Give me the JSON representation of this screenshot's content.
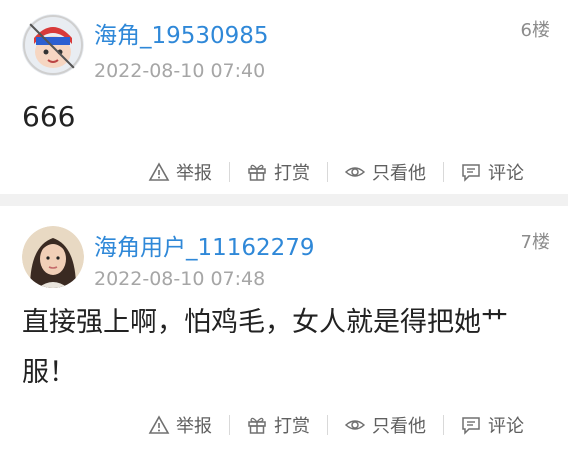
{
  "posts": [
    {
      "username": "海角_19530985",
      "floor": "6楼",
      "time": "2022-08-10 07:40",
      "content": "666",
      "actions": {
        "report": "举报",
        "tip": "打赏",
        "only_him": "只看他",
        "comment": "评论"
      }
    },
    {
      "username": "海角用户_11162279",
      "floor": "7楼",
      "time": "2022-08-10 07:48",
      "content": "直接强上啊，怕鸡毛，女人就是得把她艹服！",
      "actions": {
        "report": "举报",
        "tip": "打赏",
        "only_him": "只看他",
        "comment": "评论"
      }
    }
  ],
  "colors": {
    "username": "#2f88d8",
    "meta": "#a6a6a6",
    "divider": "#f1f1f1"
  },
  "icons": [
    "warning-triangle-icon",
    "gift-icon",
    "eye-icon",
    "comment-icon"
  ]
}
